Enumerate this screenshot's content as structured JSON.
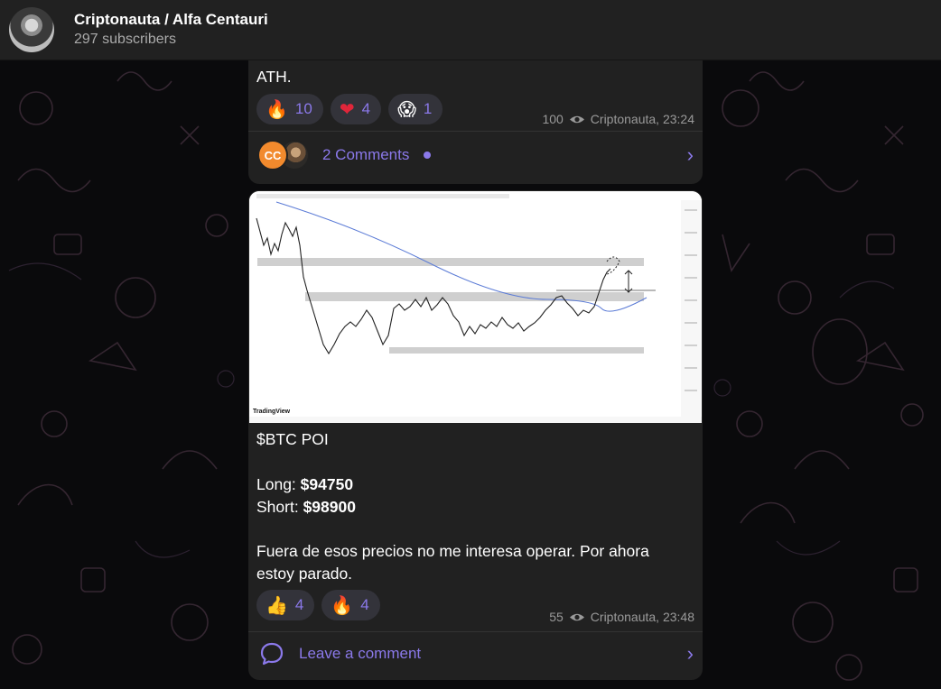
{
  "header": {
    "title": "Criptonauta / Alfa Centauri",
    "subscribers": "297 subscribers"
  },
  "message1": {
    "text_tail": "ATH.",
    "reactions": [
      {
        "emoji": "🔥",
        "count": "10",
        "icon": "fire-icon"
      },
      {
        "emoji": "❤",
        "count": "4",
        "icon": "heart-icon"
      },
      {
        "emoji": "😱",
        "count": "1",
        "icon": "scream-icon"
      }
    ],
    "views": "100",
    "author_time": "Criptonauta, 23:24",
    "comments_avatar_initials": "CC",
    "comments_label": "2 Comments"
  },
  "message2": {
    "chart_watermark": "TradingView",
    "title": "$BTC POI",
    "long_label": "Long:",
    "long_value": "$94750",
    "short_label": "Short:",
    "short_value": "$98900",
    "body": "Fuera de esos precios no me interesa operar. Por ahora\nestoy parado.",
    "reactions": [
      {
        "emoji": "👍",
        "count": "4",
        "icon": "thumbs-up-icon"
      },
      {
        "emoji": "🔥",
        "count": "4",
        "icon": "fire-icon"
      }
    ],
    "views": "55",
    "author_time": "Criptonauta, 23:48",
    "comment_label": "Leave a comment"
  },
  "colors": {
    "accent": "#8b79ea",
    "bubble": "#212121",
    "background": "#0a0a0c",
    "cc_avatar": "#f28a2d"
  }
}
